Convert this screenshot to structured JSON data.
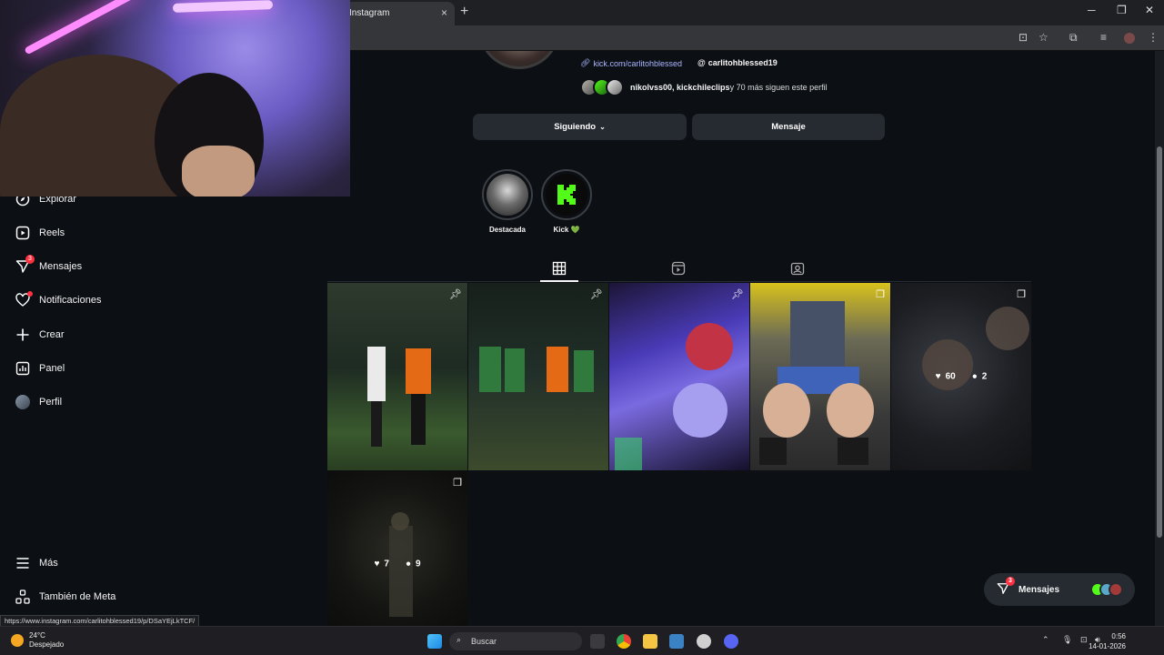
{
  "browser": {
    "tab_title": "Instagram",
    "tab_close": "×",
    "new_tab": "+",
    "status_url": "https://www.instagram.com/carlitohblessed19/p/DSaYEjLkTCF/"
  },
  "sidebar": {
    "items": [
      {
        "label": "Explorar",
        "icon": "compass-icon"
      },
      {
        "label": "Reels",
        "icon": "reels-icon"
      },
      {
        "label": "Mensajes",
        "icon": "messenger-icon",
        "badge": "3"
      },
      {
        "label": "Notificaciones",
        "icon": "heart-icon"
      },
      {
        "label": "Crear",
        "icon": "plus-icon"
      },
      {
        "label": "Panel",
        "icon": "dashboard-icon"
      },
      {
        "label": "Perfil",
        "icon": "avatar"
      },
      {
        "label": "Más",
        "icon": "menu-icon"
      },
      {
        "label": "También de Meta",
        "icon": "meta-icon"
      }
    ]
  },
  "profile": {
    "link": "kick.com/carlitohblessed",
    "threads_handle": "carlitohblessed19",
    "followed_by_names": "nikolvss00, kickchileclips",
    "followed_by_rest": " y 70 más siguen este perfil",
    "following_button": "Siguiendo",
    "message_button": "Mensaje"
  },
  "highlights": [
    {
      "label": "Destacada"
    },
    {
      "label": "Kick 💚"
    }
  ],
  "posts": [
    {
      "pinned": true,
      "likes": "",
      "comments": ""
    },
    {
      "pinned": true,
      "likes": "",
      "comments": ""
    },
    {
      "pinned": true,
      "likes": "",
      "comments": ""
    },
    {
      "pinned": false,
      "likes": "",
      "comments": ""
    },
    {
      "pinned": false,
      "likes": "60",
      "comments": "2"
    },
    {
      "pinned": false,
      "likes": "7",
      "comments": "9"
    }
  ],
  "messages_pill": {
    "label": "Mensajes",
    "badge": "3"
  },
  "taskbar": {
    "temperature": "24°C",
    "weather": "Despejado",
    "search": "Buscar",
    "time": "0:56",
    "date": "14-01-2026"
  },
  "colors": {
    "accent_red": "#ff3040",
    "link": "#a9b6ff",
    "kick_green": "#53fc18"
  }
}
